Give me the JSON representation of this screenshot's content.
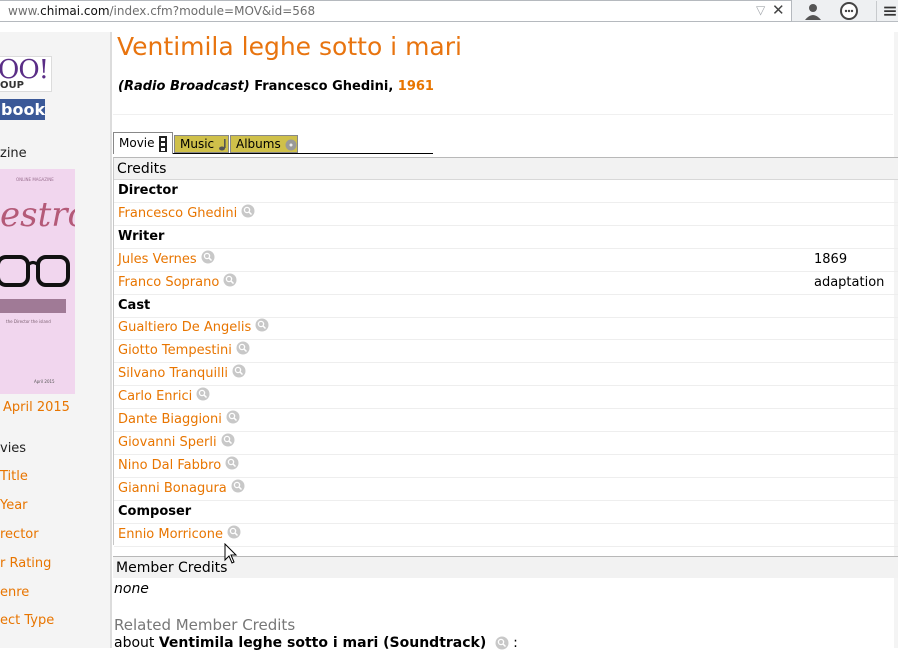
{
  "browser": {
    "url_prefix": "www.",
    "url_domain": "chimai.com",
    "url_path": "/index.cfm?module=MOV&id=568"
  },
  "sidebar": {
    "yahoo_text": "OO!",
    "yahoo_sub": "OUP",
    "facebook_text": "book",
    "magazine_label": "zine",
    "magazine_masthead": "estro",
    "magazine_top": "ONLINE MAGAZINE",
    "magazine_dedication": "m is dedicated to the memory of Dino Risoni",
    "magazine_small": "the Director the island",
    "magazine_date": "April 2015",
    "issue_link": "April 2015",
    "movies_heading": "vies",
    "links": [
      "Title",
      "Year",
      "rector",
      "r Rating",
      "enre",
      "ect Type"
    ]
  },
  "page": {
    "title": "Ventimila leghe sotto i mari",
    "medium": "(Radio Broadcast)",
    "director_name": "Francesco Ghedini,",
    "year": "1961"
  },
  "tabs": [
    {
      "label": "Movie"
    },
    {
      "label": "Music"
    },
    {
      "label": "Albums"
    }
  ],
  "credits": {
    "heading": "Credits",
    "rows": [
      {
        "type": "role",
        "text": "Director"
      },
      {
        "type": "person",
        "text": "Francesco Ghedini",
        "note": ""
      },
      {
        "type": "role",
        "text": "Writer"
      },
      {
        "type": "person",
        "text": "Jules Vernes",
        "note": "1869"
      },
      {
        "type": "person",
        "text": "Franco Soprano",
        "note": "adaptation"
      },
      {
        "type": "role",
        "text": "Cast"
      },
      {
        "type": "person",
        "text": "Gualtiero De Angelis",
        "note": ""
      },
      {
        "type": "person",
        "text": "Giotto Tempestini",
        "note": ""
      },
      {
        "type": "person",
        "text": "Silvano Tranquilli",
        "note": ""
      },
      {
        "type": "person",
        "text": "Carlo Enrici",
        "note": ""
      },
      {
        "type": "person",
        "text": "Dante Biaggioni",
        "note": ""
      },
      {
        "type": "person",
        "text": "Giovanni Sperli",
        "note": ""
      },
      {
        "type": "person",
        "text": "Nino Dal Fabbro",
        "note": ""
      },
      {
        "type": "person",
        "text": "Gianni Bonagura",
        "note": ""
      },
      {
        "type": "role",
        "text": "Composer"
      },
      {
        "type": "person",
        "text": "Ennio Morricone",
        "note": ""
      }
    ]
  },
  "member_credits": {
    "heading": "Member Credits",
    "value": "none"
  },
  "related": {
    "heading": "Related Member Credits",
    "prefix": "about",
    "title": "Ventimila leghe sotto i mari (Soundtrack)",
    "suffix": ":"
  },
  "colors": {
    "accent": "#e87500",
    "tab_inactive": "#cfc04a"
  }
}
